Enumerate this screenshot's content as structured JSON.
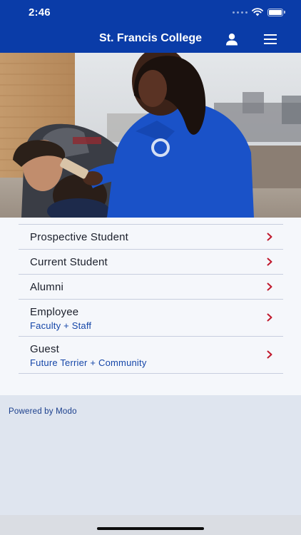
{
  "status_bar": {
    "time": "2:46",
    "icons": [
      "signal-icon",
      "wifi-icon",
      "battery-icon"
    ]
  },
  "header": {
    "title": "St. Francis College",
    "profile_icon": "person-icon",
    "menu_icon": "hamburger-menu-icon",
    "background_color": "#0a3ca8"
  },
  "hero": {
    "image": "students-on-rooftop-photo"
  },
  "menu": {
    "items": [
      {
        "label": "Prospective Student",
        "sub": ""
      },
      {
        "label": "Current Student",
        "sub": ""
      },
      {
        "label": "Alumni",
        "sub": ""
      },
      {
        "label": "Employee",
        "sub": "Faculty + Staff"
      },
      {
        "label": "Guest",
        "sub": "Future Terrier + Community"
      }
    ],
    "chevron_icon": "chevron-right-icon",
    "chevron_color": "#c0182c",
    "subtitle_color": "#1546a8"
  },
  "footer": {
    "powered_by": "Powered by Modo"
  }
}
